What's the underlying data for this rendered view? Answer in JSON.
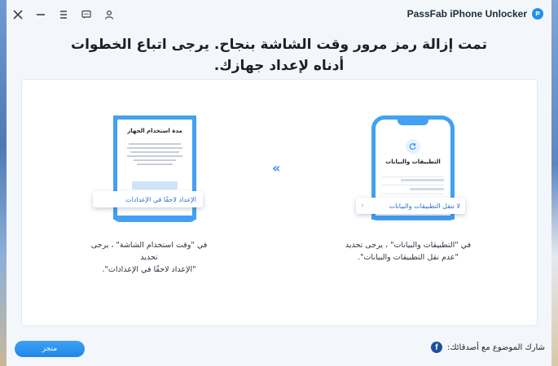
{
  "app": {
    "title": "PassFab iPhone Unlocker",
    "accent": "#1f8ff0"
  },
  "titlebar": {
    "icons": [
      "close-icon",
      "minimize-icon",
      "menu-icon",
      "feedback-icon",
      "account-icon"
    ]
  },
  "heading": {
    "text": "تمت إزالة رمز مرور وقت الشاشة بنجاح. يرجى اتباع الخطوات أدناه لإعداد جهازك."
  },
  "steps": {
    "right": {
      "screen_title": "التطبيقات والبيانات",
      "callout": "لا تنقل التطبيقات والبيانات",
      "caption_line1": "في \"التطبيقات والبيانات\" ، يرجى تحديد",
      "caption_line2": "\"عدم نقل التطبيقات والبيانات\"."
    },
    "left": {
      "screen_title": "مدة استخدام الجهاز",
      "callout": "الإعداد لاحقًا في الإعدادات",
      "caption_line1": "في \"وقت استخدام الشاشة\" ، يرجى تحديد",
      "caption_line2": "\"الإعداد لاحقًا في الإعدادات\"."
    },
    "arrow": "«"
  },
  "footer": {
    "done_label": "منجز",
    "share_label": "شارك الموضوع مع أصدقائك:"
  }
}
